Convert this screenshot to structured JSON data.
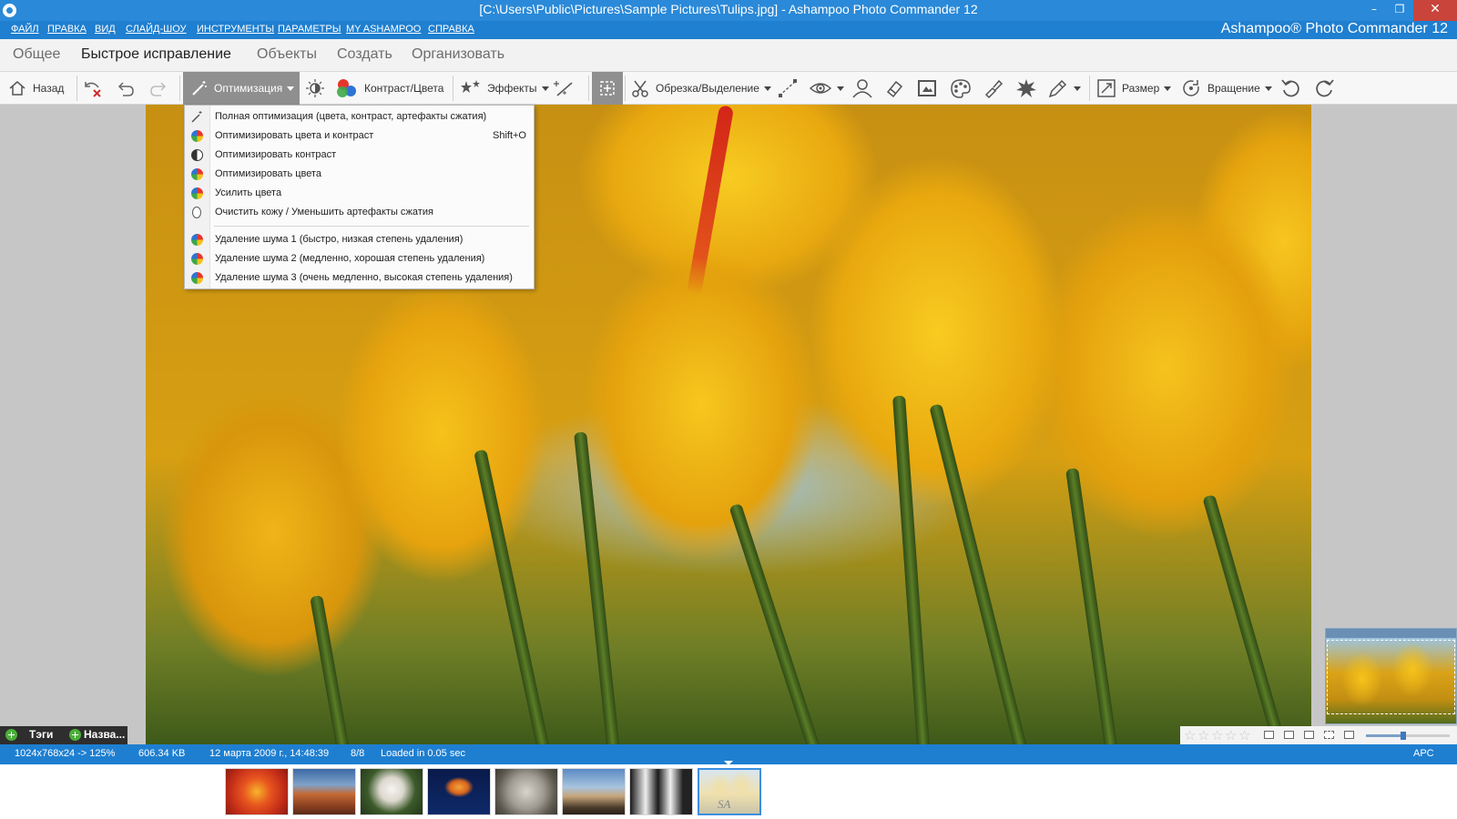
{
  "window": {
    "title": "[C:\\Users\\Public\\Pictures\\Sample Pictures\\Tulips.jpg] - Ashampoo Photo Commander 12",
    "minimize": "–",
    "maximize": "❐",
    "close": "✕"
  },
  "menubar": {
    "items": [
      "ФАЙЛ",
      "ПРАВКА",
      "ВИД",
      "СЛАЙД-ШОУ",
      "ИНСТРУМЕНТЫ",
      "ПАРАМЕТРЫ",
      "MY ASHAMPOO",
      "СПРАВКА"
    ],
    "brand": "Ashampoo® Photo Commander 12"
  },
  "tabs": {
    "items": [
      "Общее",
      "Быстрое исправление",
      "Объекты",
      "Создать",
      "Организовать"
    ],
    "active": "Быстрое исправление"
  },
  "toolbar": {
    "back": "Назад",
    "optimize": "Оптимизация",
    "contrast_colors": "Контраст/Цвета",
    "effects": "Эффекты",
    "crop": "Обрезка/Выделение",
    "size": "Размер",
    "rotate": "Вращение"
  },
  "dropdown": {
    "items": [
      {
        "label": "Полная оптимизация (цвета, контраст, артефакты сжатия)",
        "shortcut": "",
        "icon": "magic-wand-icon"
      },
      {
        "label": "Оптимизировать цвета и контраст",
        "shortcut": "Shift+O",
        "icon": "color-wheel-icon"
      },
      {
        "label": "Оптимизировать контраст",
        "shortcut": "",
        "icon": "contrast-icon"
      },
      {
        "label": "Оптимизировать цвета",
        "shortcut": "",
        "icon": "color-wheel-icon"
      },
      {
        "label": "Усилить цвета",
        "shortcut": "",
        "icon": "color-wheel-icon"
      },
      {
        "label": "Очистить кожу / Уменьшить артефакты сжатия",
        "shortcut": "",
        "icon": "drop-icon"
      },
      {
        "label": "Удаление шума 1 (быстро, низкая степень удаления)",
        "shortcut": "",
        "icon": "color-wheel-icon"
      },
      {
        "label": "Удаление шума 2 (медленно, хорошая степень удаления)",
        "shortcut": "",
        "icon": "color-wheel-icon"
      },
      {
        "label": "Удаление шума 3 (очень медленно, высокая степень удаления)",
        "shortcut": "",
        "icon": "color-wheel-icon"
      }
    ]
  },
  "tagsbar": {
    "tags": "Тэги",
    "names": "Назва..."
  },
  "status": {
    "dimensions": "1024x768x24 -> 125%",
    "filesize": "606.34 KB",
    "date": "12 марта 2009 г., 14:48:39",
    "position": "8/8",
    "loaded": "Loaded in 0.05 sec",
    "apc": "APC"
  },
  "rating": {
    "stars": 0,
    "max": 5,
    "star_glyph": "☆",
    "zoom": 0.45
  },
  "filmstrip": {
    "selected_index": 7,
    "watermark": "SA"
  },
  "colors": {
    "accent": "#1e7fd1",
    "title": "#2a89d8"
  }
}
